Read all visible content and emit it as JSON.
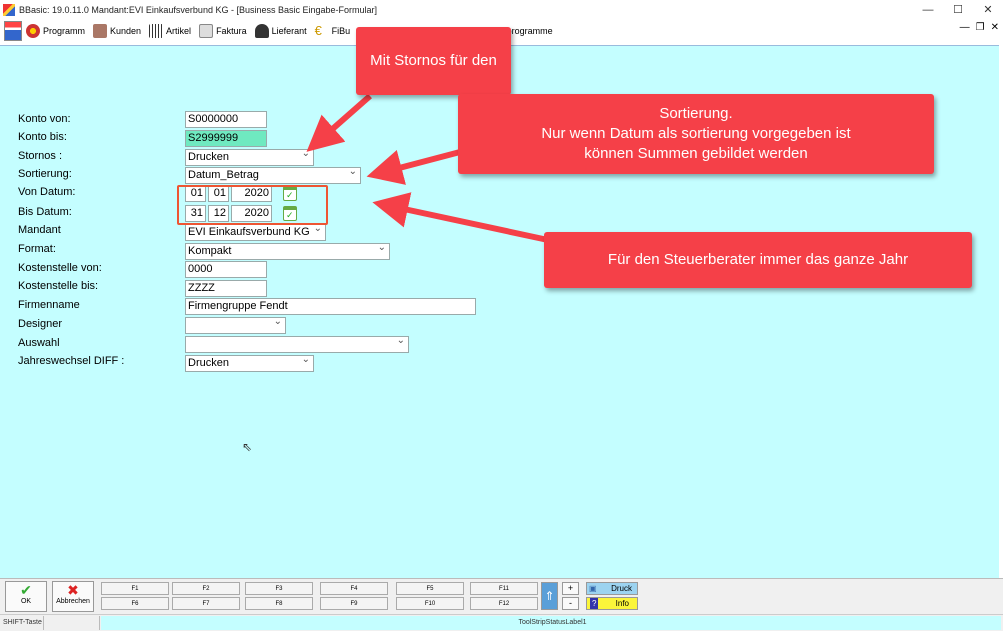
{
  "window": {
    "title": "BBasic: 19.0.11.0 Mandant:EVI Einkaufsverbund KG  - [Business Basic Eingabe-Formular]"
  },
  "menu": {
    "programm": "Programm",
    "kunden": "Kunden",
    "artikel": "Artikel",
    "faktura": "Faktura",
    "lieferant": "Lieferant",
    "fibu": "FiBu",
    "zusatz": "satzprogramme"
  },
  "form": {
    "konto_von": {
      "label": "Konto von:",
      "value": "S0000000"
    },
    "konto_bis": {
      "label": "Konto bis:",
      "value": "S2999999"
    },
    "stornos": {
      "label": "Stornos :",
      "value": "Drucken"
    },
    "sortierung": {
      "label": "Sortierung:",
      "value": "Datum_Betrag"
    },
    "von_datum": {
      "label": "Von Datum:",
      "day": "01",
      "month": "01",
      "year": "2020"
    },
    "bis_datum": {
      "label": "Bis Datum:",
      "day": "31",
      "month": "12",
      "year": "2020"
    },
    "mandant": {
      "label": "Mandant",
      "value": "EVI Einkaufsverbund KG"
    },
    "format": {
      "label": "Format:",
      "value": "Kompakt"
    },
    "kst_von": {
      "label": "Kostenstelle von:",
      "value": "0000"
    },
    "kst_bis": {
      "label": "Kostenstelle bis:",
      "value": "ZZZZ"
    },
    "firmenname": {
      "label": "Firmenname",
      "value": "Firmengruppe Fendt"
    },
    "designer": {
      "label": "Designer",
      "value": ""
    },
    "auswahl": {
      "label": "Auswahl",
      "value": ""
    },
    "jahreswechsel": {
      "label": "Jahreswechsel DIFF :",
      "value": "Drucken"
    }
  },
  "callouts": {
    "stornos": "Mit Stornos für den",
    "sortierung_1": "Sortierung.",
    "sortierung_2": "Nur wenn Datum als sortierung vorgegeben ist",
    "sortierung_3": "können Summen gebildet werden",
    "jahr": "Für den Steuerberater immer das ganze Jahr"
  },
  "toolbar": {
    "ok": "OK",
    "abbrechen": "Abbrechen",
    "f1": "F1",
    "f2": "F2",
    "f3": "F3",
    "f4": "F4",
    "f5": "F5",
    "f11": "F11",
    "f6": "F6",
    "f7": "F7",
    "f8": "F8",
    "f9": "F9",
    "f10": "F10",
    "f12": "F12",
    "plus": "+",
    "minus": "-",
    "druck": "Druck",
    "info": "Info"
  },
  "status": {
    "shift": "SHIFT-Taste",
    "label1": "ToolStripStatusLabel1"
  },
  "colors": {
    "form_bg": "#c4feff",
    "callout": "#f54048",
    "focus": "#6fe9c0"
  }
}
